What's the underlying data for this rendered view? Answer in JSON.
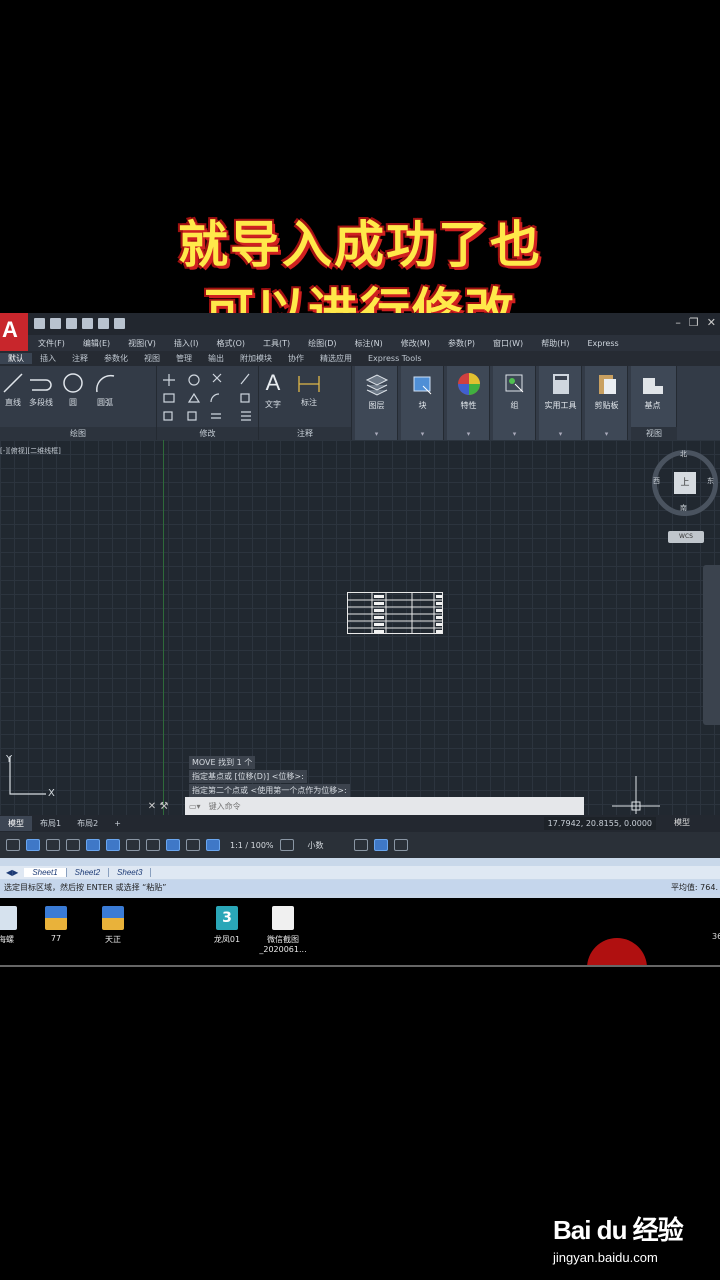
{
  "caption": {
    "line1": "就导入成功了也",
    "line2": "可以进行修改"
  },
  "app": {
    "logo": "A",
    "menus": [
      "文件(F)",
      "编辑(E)",
      "视图(V)",
      "插入(I)",
      "格式(O)",
      "工具(T)",
      "绘图(D)",
      "标注(N)",
      "修改(M)",
      "参数(P)",
      "窗口(W)",
      "帮助(H)",
      "Express"
    ],
    "tabs": [
      "默认",
      "插入",
      "注释",
      "参数化",
      "视图",
      "管理",
      "输出",
      "附加模块",
      "协作",
      "精选应用",
      "Express Tools"
    ],
    "ribbon": {
      "draw_tools": [
        "直线",
        "多段线",
        "圆",
        "圆弧"
      ],
      "text_tools": [
        "文字",
        "标注"
      ],
      "big_buttons": [
        "图层",
        "块",
        "特性",
        "组",
        "实用工具",
        "剪贴板",
        "基点"
      ],
      "group_labels": [
        "绘图",
        "修改",
        "注释",
        "视图"
      ]
    },
    "viewport_label": "[-][俯视][二维线框]",
    "compass": {
      "north": "北",
      "south": "南",
      "east": "东",
      "west": "西",
      "top": "上"
    },
    "wcs": "WCS",
    "command_history": [
      "MOVE 找到 1 个",
      "指定基点或 [位移(D)] <位移>:",
      "指定第二个点或 <使用第一个点作为位移>:"
    ],
    "command_placeholder": "键入命令",
    "layout_tabs": [
      "模型",
      "布局1",
      "布局2"
    ],
    "coordinates": "17.7942, 20.8155, 0.0000",
    "model_label": "模型",
    "scale": "1:1 / 100%",
    "units": "小数"
  },
  "excel": {
    "sheets": [
      "Sheet1",
      "Sheet2",
      "Sheet3"
    ],
    "status": "选定目标区域，然后按 ENTER 或选择 “粘贴”",
    "average": "平均值: 764."
  },
  "desktop": {
    "icons": [
      "海螺",
      "77",
      "天正",
      "龙凤01",
      "微信截图_2020061..."
    ],
    "right_text": "36"
  },
  "watermark": {
    "brand": "Bai du 经验",
    "url": "jingyan.baidu.com"
  },
  "colors": {
    "caption": "#ffe94a",
    "caption_shadow": "#d02020",
    "autocad_red": "#c8262c",
    "viewport_bg": "#212830"
  }
}
